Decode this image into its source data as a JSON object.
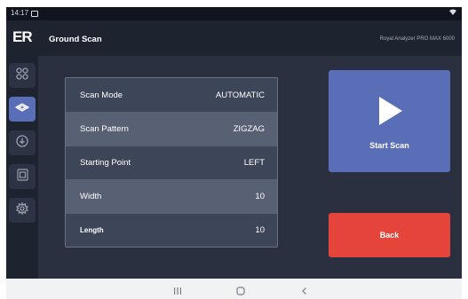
{
  "status_bar": {
    "time": "14:17",
    "status_icon": "gallery-icon",
    "signal_icon": "wifi-icon"
  },
  "app_bar": {
    "logo": "ER",
    "title": "Ground Scan",
    "device_name": "Royal Analyzer PRO MAX 6000"
  },
  "sidebar": {
    "items": [
      {
        "icon": "grid-icon",
        "active": false
      },
      {
        "icon": "scan-icon",
        "active": true
      },
      {
        "icon": "download-icon",
        "active": false
      },
      {
        "icon": "3d-icon",
        "active": false
      },
      {
        "icon": "gear-icon",
        "active": false
      }
    ]
  },
  "settings": [
    {
      "label": "Scan Mode",
      "value": "AUTOMATIC"
    },
    {
      "label": "Scan Pattern",
      "value": "ZIGZAG"
    },
    {
      "label": "Starting Point",
      "value": "LEFT"
    },
    {
      "label": "Width",
      "value": "10"
    },
    {
      "label": "Length",
      "value": "10"
    }
  ],
  "actions": {
    "start_label": "Start Scan",
    "back_label": "Back"
  },
  "colors": {
    "accent": "#5a6db7",
    "danger": "#e4443a",
    "background": "#2a3040"
  },
  "nav_bar": {
    "items": [
      "recent-apps-icon",
      "home-icon",
      "back-icon"
    ]
  }
}
